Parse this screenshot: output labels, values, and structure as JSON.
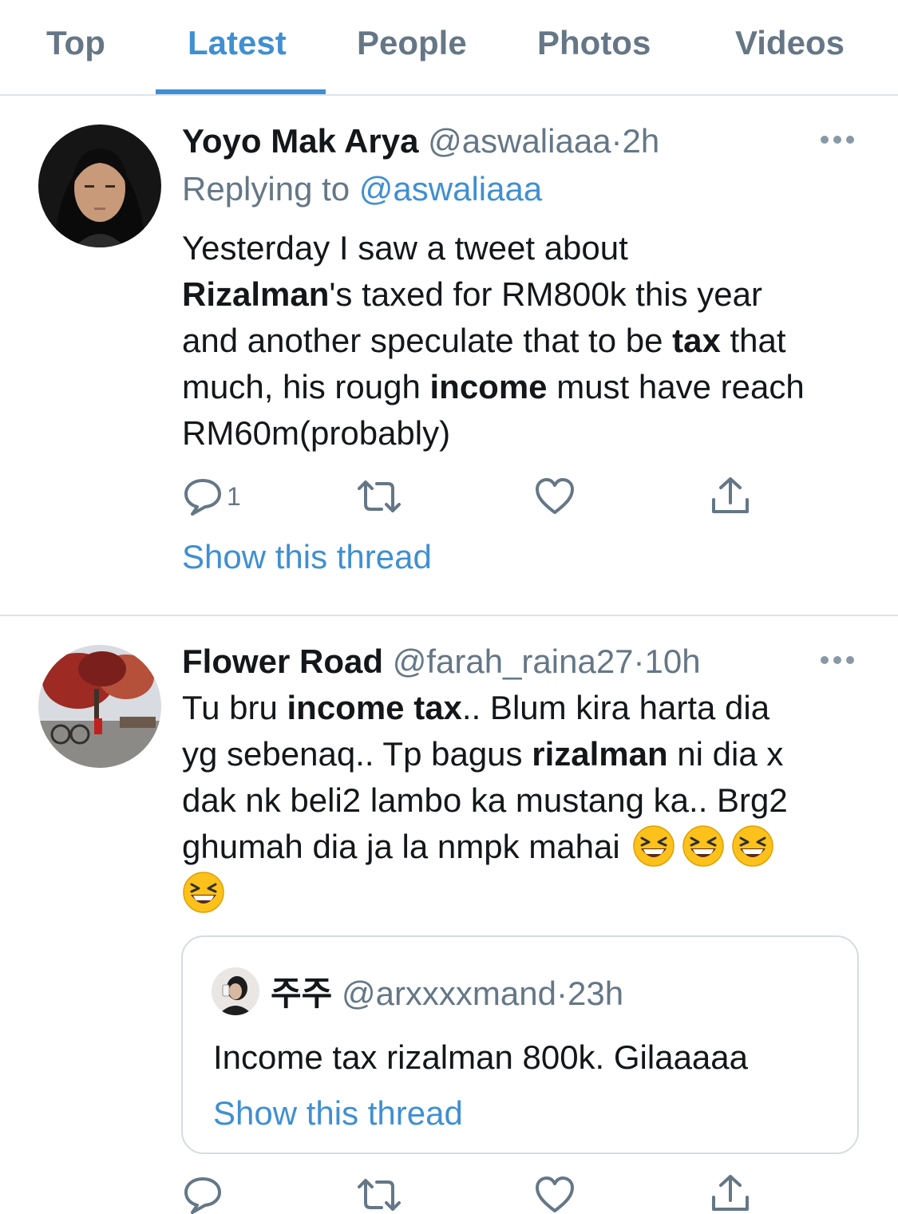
{
  "tabs": [
    "Top",
    "Latest",
    "People",
    "Photos",
    "Videos"
  ],
  "active_tab": "Latest",
  "tweets": [
    {
      "name": "Yoyo Mak Arya",
      "handle": "@aswaliaaa",
      "sep": "·",
      "time": "2h",
      "replying_prefix": "Replying to",
      "replying_to": "@aswaliaaa",
      "text": {
        "l1": "Yesterday I saw a tweet about",
        "l2a": "Rizalman",
        "l2b": "'s taxed for RM800k this year",
        "l3a": "and another speculate that to be ",
        "l3b": "tax",
        "l3c": " that",
        "l4a": "much, his rough ",
        "l4b": "income",
        "l4c": " must have reach",
        "l5": "RM60m(probably)"
      },
      "reply_count": "1",
      "show_thread": "Show this thread"
    },
    {
      "name": "Flower Road",
      "handle": "@farah_raina27",
      "sep": "·",
      "time": "10h",
      "text": {
        "l1a": "Tu bru ",
        "l1b": "income tax",
        "l1c": ".. Blum kira harta dia",
        "l2a": "yg sebenaq.. Tp bagus ",
        "l2b": "rizalman",
        "l2c": " ni dia x",
        "l3": "dak nk beli2 lambo ka mustang ka.. Brg2",
        "l4": "ghumah dia ja la nmpk mahai"
      },
      "emoji": "laughing-squinting-face",
      "quote": {
        "name": "주주",
        "handle": "@arxxxxmand",
        "sep": "·",
        "time": "23h",
        "text": "Income tax rizalman 800k. Gilaaaaa",
        "show_thread": "Show this thread"
      }
    }
  ],
  "icons": [
    "reply-icon",
    "retweet-icon",
    "like-icon",
    "share-icon",
    "more-icon"
  ],
  "colors": {
    "accent": "#3f8fd2",
    "muted": "#657786",
    "text": "#14171a",
    "border": "#dfe3e7"
  }
}
